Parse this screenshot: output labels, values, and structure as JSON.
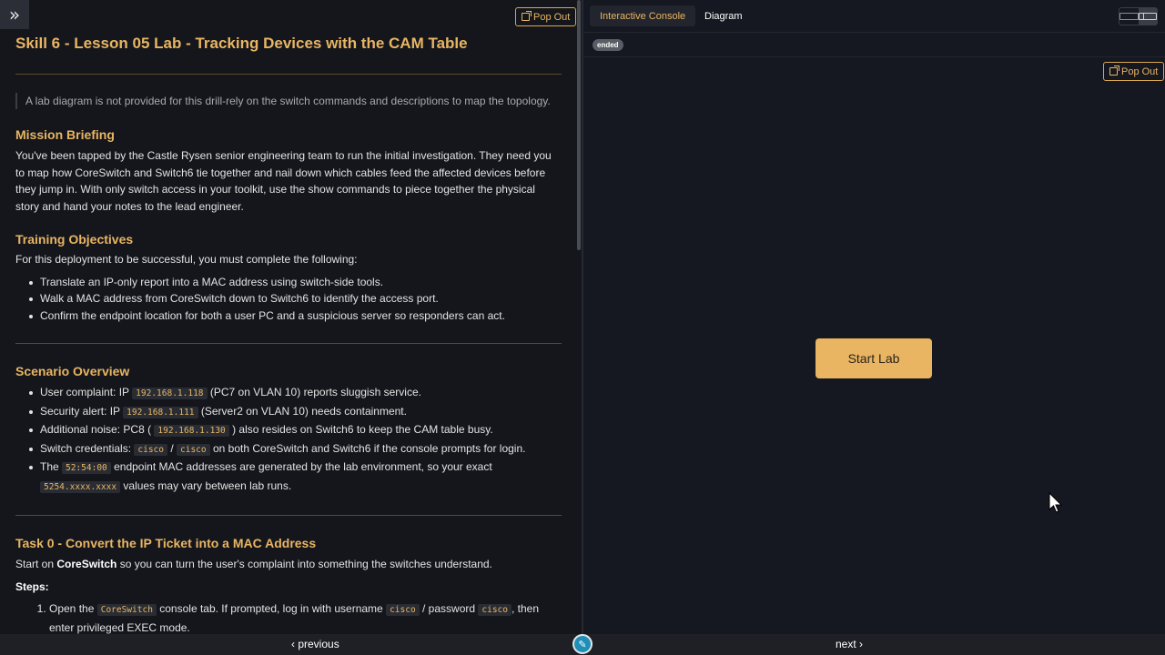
{
  "sidebar_toggle": {
    "icon": "double-chevron-right-icon",
    "glyph": "»"
  },
  "left_pane": {
    "pop_out_label": "Pop Out",
    "title": "Skill 6 - Lesson 05 Lab - Tracking Devices with the CAM Table",
    "note": "A lab diagram is not provided for this drill-rely on the switch commands and descriptions to map the topology.",
    "mission": {
      "heading": "Mission Briefing",
      "body": "You've been tapped by the Castle Rysen senior engineering team to run the initial investigation. They need you to map how CoreSwitch and Switch6 tie together and nail down which cables feed the affected devices before they jump in. With only switch access in your toolkit, use the show commands to piece together the physical story and hand your notes to the lead engineer."
    },
    "objectives": {
      "heading": "Training Objectives",
      "intro": "For this deployment to be successful, you must complete the following:",
      "items": [
        "Translate an IP-only report into a MAC address using switch-side tools.",
        "Walk a MAC address from CoreSwitch down to Switch6 to identify the access port.",
        "Confirm the endpoint location for both a user PC and a suspicious server so responders can act."
      ]
    },
    "scenario": {
      "heading": "Scenario Overview",
      "item1": {
        "a": "User complaint: IP ",
        "code": "192.168.1.118",
        "b": " (PC7 on VLAN 10) reports sluggish service."
      },
      "item2": {
        "a": "Security alert: IP ",
        "code": "192.168.1.111",
        "b": " (Server2 on VLAN 10) needs containment."
      },
      "item3": {
        "a": "Additional noise: PC8 ( ",
        "code": "192.168.1.130",
        "b": " ) also resides on Switch6 to keep the CAM table busy."
      },
      "item4": {
        "a": "Switch credentials: ",
        "code1": "cisco",
        "sep": " / ",
        "code2": "cisco",
        "b": " on both CoreSwitch and Switch6 if the console prompts for login."
      },
      "item5": {
        "a": "The ",
        "code1": "52:54:00",
        "b": " endpoint MAC addresses are generated by the lab environment, so your exact",
        "code2": "5254.xxxx.xxxx",
        "c": " values may vary between lab runs."
      }
    },
    "task0": {
      "heading": "Task 0 - Convert the IP Ticket into a MAC Address",
      "intro_a": "Start on ",
      "intro_strong": "CoreSwitch",
      "intro_b": " so you can turn the user's complaint into something the switches understand.",
      "steps_label": "Steps:",
      "step1": {
        "a": "Open the ",
        "code1": "CoreSwitch",
        "b": " console tab. If prompted, log in with username ",
        "code2": "cisco",
        "c": " / password ",
        "code3": "cisco",
        "d": ", then",
        "e": "enter privileged EXEC mode."
      }
    }
  },
  "right_pane": {
    "tabs": [
      "Interactive Console",
      "Diagram"
    ],
    "layout_toggle": {
      "left_icon": "single-pane-icon",
      "right_icon": "split-pane-icon"
    },
    "status_badge": "ended",
    "pop_out_label": "Pop Out",
    "start_button": "Start Lab"
  },
  "bottom_nav": {
    "previous": "‹ previous",
    "next": "next ›",
    "edit_icon": "pencil-icon"
  },
  "colors": {
    "accent": "#e9b562",
    "background": "#151820",
    "badge": "#5a5d66",
    "edit_button": "#1f8fb8"
  }
}
